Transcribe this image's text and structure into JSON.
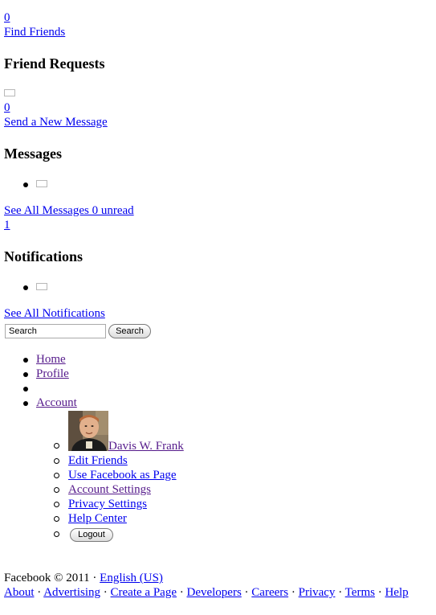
{
  "friend_requests": {
    "count": "0",
    "find_friends_link": "Find Friends",
    "heading": "Friend Requests"
  },
  "messages": {
    "count": "0",
    "send_link": "Send a New Message",
    "heading": "Messages",
    "see_all_link": "See All Messages 0 unread"
  },
  "notifications": {
    "count": "1",
    "heading": "Notifications",
    "see_all_link": "See All Notifications"
  },
  "search": {
    "placeholder": "Search",
    "button_label": "Search"
  },
  "nav": {
    "home": "Home",
    "profile": "Profile",
    "account": "Account"
  },
  "account_menu": {
    "user_name": "Davis W. Frank",
    "edit_friends": "Edit Friends",
    "use_as_page": "Use Facebook as Page",
    "account_settings": "Account Settings",
    "privacy_settings": "Privacy Settings",
    "help_center": "Help Center",
    "logout": "Logout"
  },
  "footer": {
    "copyright": "Facebook © 2011 ·",
    "language": "English (US)",
    "links": [
      "About",
      "Advertising",
      "Create a Page",
      "Developers",
      "Careers",
      "Privacy",
      "Terms",
      "Help"
    ],
    "separator": "·"
  },
  "colors": {
    "link": "#0000ee",
    "visited_link": "#551a8b"
  }
}
